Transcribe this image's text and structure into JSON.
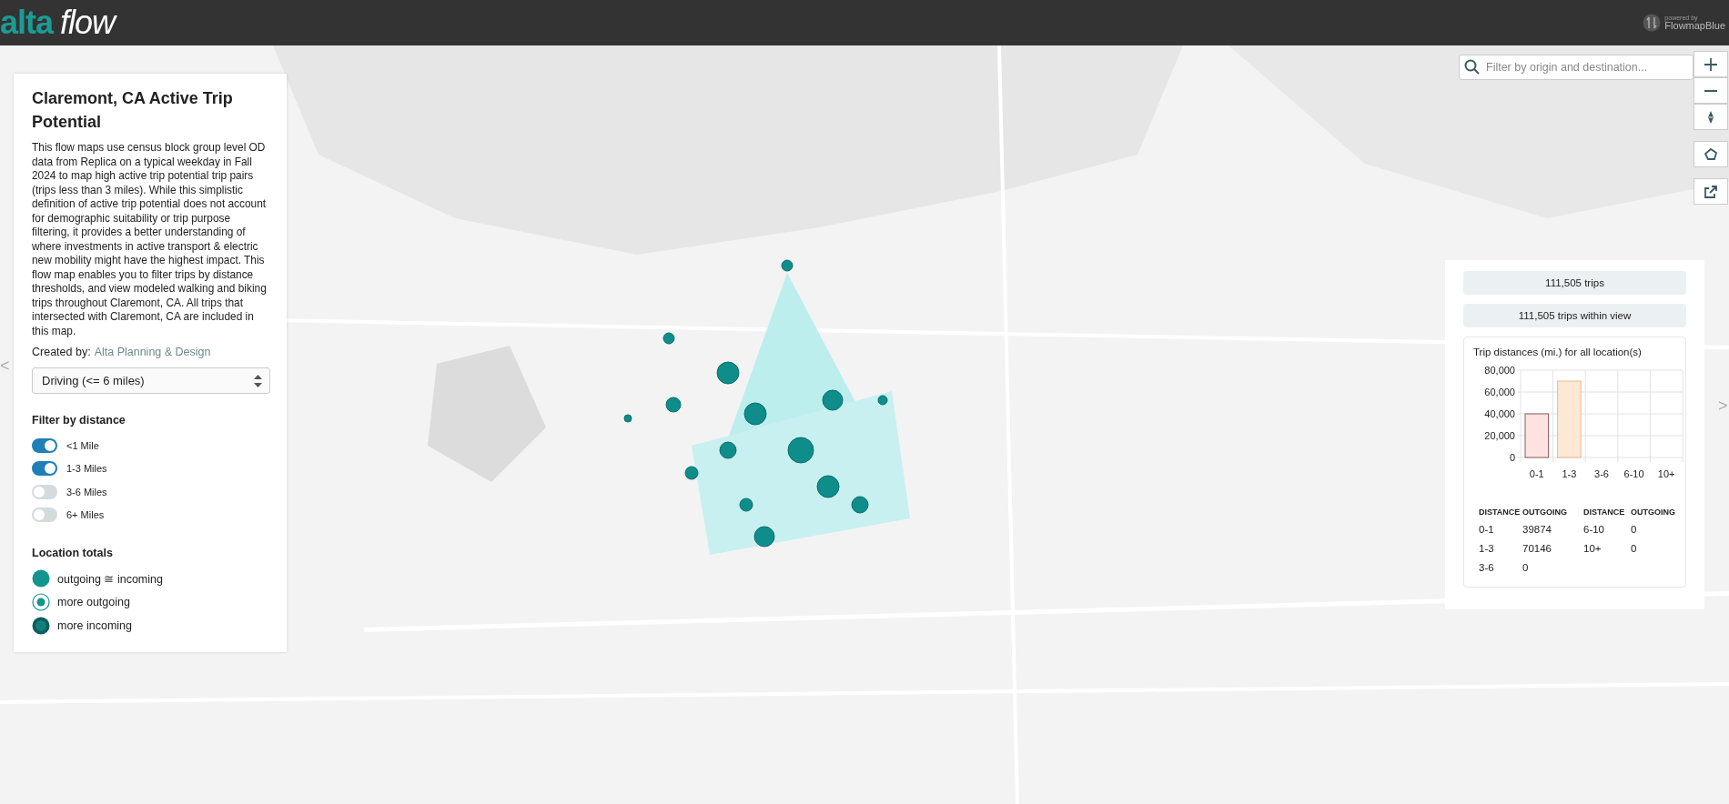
{
  "header": {
    "logo_bold": "alta",
    "logo_light": "flow",
    "powered_by": "powered by",
    "powered_brand": "FlowmapBlue"
  },
  "info_panel": {
    "title": "Claremont, CA Active Trip Potential",
    "description": "This flow maps use census block group level OD data from Replica on a typical weekday in Fall 2024 to map high active trip potential trip pairs (trips less than 3 miles). While this simplistic definition of active trip potential does not account for demographic suitability or trip purpose filtering, it provides a better understanding of where investments in active transport & electric new mobility might have the highest impact. This flow map enables you to filter trips by distance thresholds, and view modeled walking and biking trips throughout Claremont, CA. All trips that intersected with Claremont, CA are included in this map.",
    "created_by_label": "Created by:",
    "created_by_link": "Alta Planning & Design",
    "mode_select": "Driving (<= 6 miles)",
    "filter_title": "Filter by distance",
    "filters": [
      {
        "label": "<1 Mile",
        "on": true
      },
      {
        "label": "1-3 Miles",
        "on": true
      },
      {
        "label": "3-6 Miles",
        "on": false
      },
      {
        "label": "6+ Miles",
        "on": false
      }
    ],
    "legend_title": "Location totals",
    "legend": [
      {
        "kind": "equal",
        "label": "outgoing ≅ incoming"
      },
      {
        "kind": "outgoing",
        "label": "more outgoing"
      },
      {
        "kind": "incoming",
        "label": "more incoming"
      }
    ]
  },
  "search": {
    "placeholder": "Filter by origin and destination..."
  },
  "map_controls": [
    {
      "kind": "zoom-in"
    },
    {
      "kind": "zoom-out"
    },
    {
      "kind": "compass"
    },
    {
      "kind": "polygon"
    },
    {
      "kind": "external"
    }
  ],
  "stats_panel": {
    "total_trips": "111,505 trips",
    "trips_in_view": "111,505 trips within view",
    "chart_title": "Trip distances (mi.) for all location(s)",
    "chart_data": {
      "type": "bar",
      "categories": [
        "0-1",
        "1-3",
        "3-6",
        "6-10",
        "10+"
      ],
      "values": [
        40000,
        70000,
        0,
        0,
        0
      ],
      "grid": true,
      "ylim": [
        0,
        80000
      ],
      "yticks": [
        {
          "value": 0,
          "label": "0"
        },
        {
          "value": 20000,
          "label": "20,000"
        },
        {
          "value": 40000,
          "label": "40,000"
        },
        {
          "value": 60000,
          "label": "60,000"
        },
        {
          "value": 80000,
          "label": "80,000"
        }
      ]
    },
    "table": {
      "columns": [
        "DISTANCE",
        "OUTGOING",
        "DISTANCE",
        "OUTGOING"
      ],
      "rows": [
        [
          "0-1",
          "39874",
          "6-10",
          "0"
        ],
        [
          "1-3",
          "70146",
          "10+",
          "0"
        ],
        [
          "3-6",
          "0"
        ]
      ]
    }
  },
  "side_toggles": {
    "left": "<",
    "right": ">"
  }
}
